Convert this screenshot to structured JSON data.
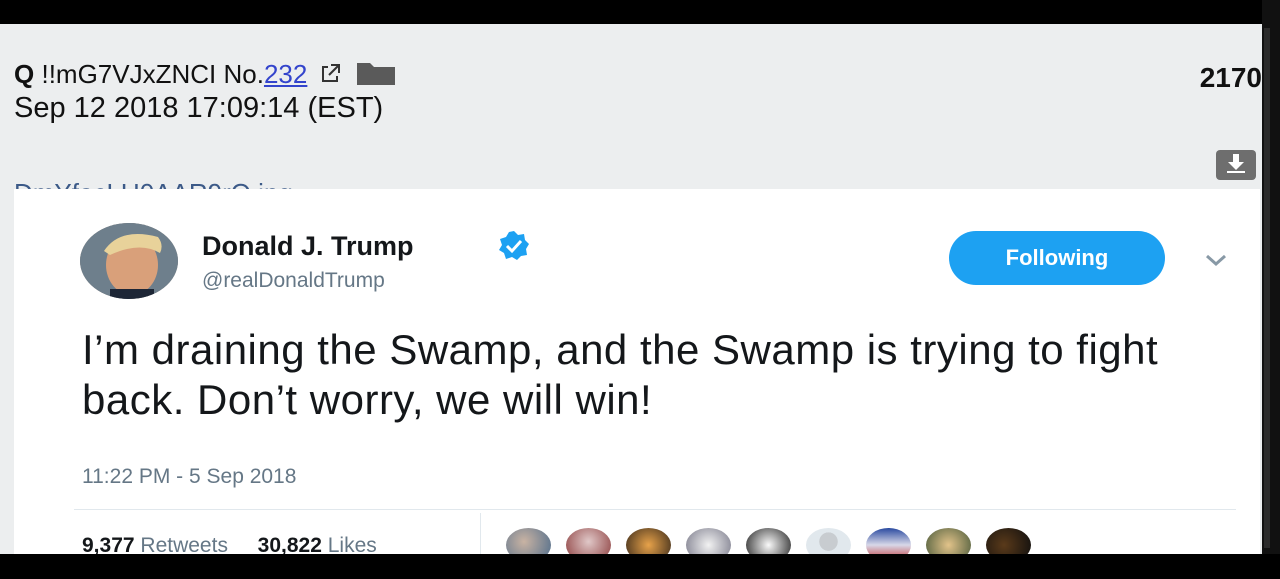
{
  "post": {
    "name": "Q",
    "tripcode": "!!mG7VJxZNCI",
    "no_label": "No.",
    "no_value": "232",
    "datetime": "Sep 12 2018 17:09:14 (EST)",
    "post_count": "2170",
    "file_name": "DmYfacLU0AAR9rQ.jpg"
  },
  "icons": {
    "external": "external-link-icon",
    "folder": "folder-icon",
    "download": "download-icon",
    "verified": "verified-badge-icon",
    "caret": "chevron-down-icon"
  },
  "tweet": {
    "author_name": "Donald J. Trump",
    "handle": "@realDonaldTrump",
    "follow_label": "Following",
    "text": "I’m draining the Swamp, and the Swamp is trying to fight back. Don’t worry, we will win!",
    "timestamp": "11:22 PM - 5 Sep 2018",
    "retweets_count": "9,377",
    "retweets_label": "Retweets",
    "likes_count": "30,822",
    "likes_label": "Likes"
  },
  "colors": {
    "twitter_blue": "#1da1f2",
    "link_blue": "#3344cc",
    "muted_gray": "#657786"
  }
}
